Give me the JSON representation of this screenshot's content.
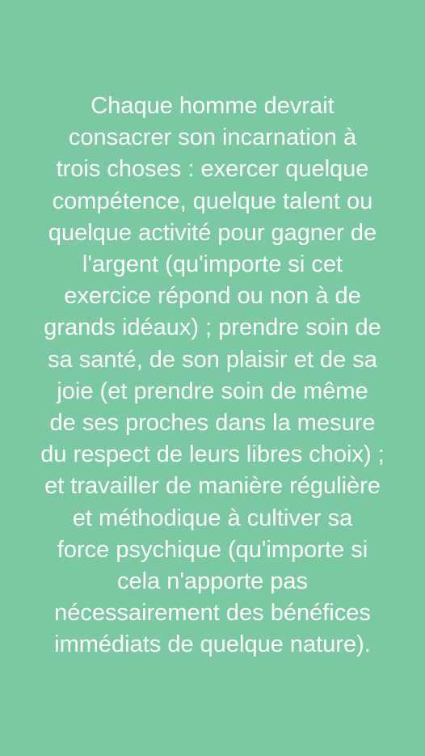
{
  "quote": {
    "lines": [
      "Chaque homme devrait",
      "consacrer son incarnation à",
      "trois choses : exercer quelque",
      "compétence, quelque talent ou",
      "quelque activité pour gagner de",
      "l'argent (qu'importe si cet",
      "exercice répond ou non à de",
      "grands idéaux) ; prendre soin de",
      "sa santé, de son plaisir et de sa",
      "joie (et prendre soin de même",
      "de ses proches dans la mesure",
      "du respect de leurs libres choix) ;",
      "et travailler de manière régulière",
      "et méthodique à cultiver sa",
      "force psychique (qu'importe si",
      "cela n'apporte pas",
      "nécessairement des bénéfices",
      "immédiats de quelque nature)."
    ]
  },
  "colors": {
    "background": "#7bc9a2",
    "text": "#ffffff"
  }
}
